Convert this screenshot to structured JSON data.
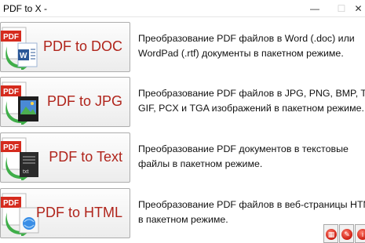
{
  "window": {
    "title": "PDF to X -",
    "minimize": "—",
    "maximize": "☐",
    "close": "✕"
  },
  "rows": [
    {
      "button": "PDF to DOC",
      "description_line1": "Преобразование PDF файлов в Word (.doc) или",
      "description_line2": "WordPad (.rtf) документы в пакетном режиме.",
      "icon": "pdf-to-word-icon"
    },
    {
      "button": "PDF to JPG",
      "description_line1": "Преобразование PDF файлов в JPG, PNG, BMP, TIF,",
      "description_line2": "GIF, PCX и TGA изображений в пакетном режиме.",
      "icon": "pdf-to-image-icon"
    },
    {
      "button": "PDF to Text",
      "description_line1": "Преобразование PDF документов в текстовые",
      "description_line2": "файлы в пакетном режиме.",
      "icon": "pdf-to-text-icon"
    },
    {
      "button": "PDF to HTML",
      "description_line1": "Преобразование PDF файлов в веб-страницы HTML",
      "description_line2": "в пакетном режиме.",
      "icon": "pdf-to-html-icon"
    }
  ],
  "icon_text": {
    "pdf": "PDF",
    "word": "W",
    "txt": "txt"
  },
  "colors": {
    "accent_red": "#b0241b",
    "pdf_red": "#d52b1e",
    "arrow_green": "#3fae49",
    "word_blue": "#2b5797"
  }
}
